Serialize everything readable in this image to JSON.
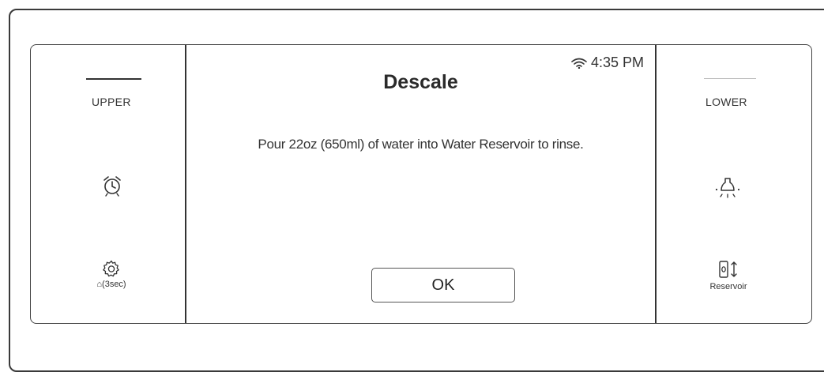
{
  "left_panel": {
    "mode_label": "UPPER",
    "alarm_icon": "alarm-clock-icon",
    "settings_icon": "gear-icon",
    "settings_label": "⌂(3sec)"
  },
  "right_panel": {
    "mode_label": "LOWER",
    "light_icon": "light-bulb-icon",
    "reservoir_icon": "reservoir-icon",
    "reservoir_label": "Reservoir"
  },
  "screen": {
    "status": {
      "wifi_icon": "wifi-icon",
      "time": "4:35 PM"
    },
    "title": "Descale",
    "message": "Pour 22oz (650ml) of water into Water Reservoir to rinse.",
    "ok_label": "OK"
  }
}
